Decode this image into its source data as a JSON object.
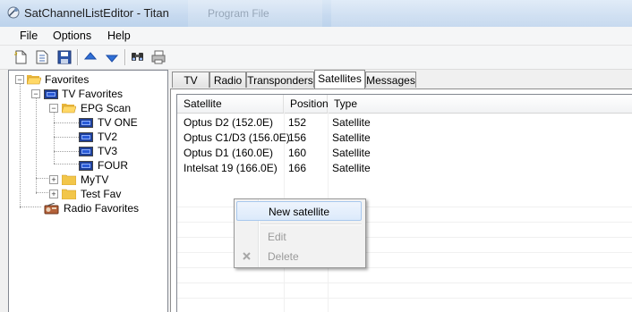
{
  "window": {
    "title": "SatChannelListEditor - Titan",
    "background_window_title": "Program File"
  },
  "menu": [
    "File",
    "Options",
    "Help"
  ],
  "toolbar": {
    "icons": [
      "new-icon",
      "new-list-icon",
      "save-icon",
      "move-up-icon",
      "move-down-icon",
      "find-icon",
      "print-icon"
    ]
  },
  "tree": {
    "favorites": "Favorites",
    "tv_favorites": "TV Favorites",
    "epg_scan": "EPG Scan",
    "channels": [
      "TV ONE",
      "TV2",
      "TV3",
      "FOUR"
    ],
    "mytv": "MyTV",
    "test_fav": "Test Fav",
    "radio_favorites": "Radio Favorites"
  },
  "tabs": [
    {
      "label": "TV"
    },
    {
      "label": "Radio"
    },
    {
      "label": "Transponders"
    },
    {
      "label": "Satellites",
      "active": true
    },
    {
      "label": "Messages"
    }
  ],
  "list": {
    "columns": [
      "Satellite",
      "Position",
      "Type"
    ],
    "rows": [
      [
        "Optus D2 (152.0E)",
        "152",
        "Satellite"
      ],
      [
        "Optus C1/D3 (156.0E)",
        "156",
        "Satellite"
      ],
      [
        "Optus D1 (160.0E)",
        "160",
        "Satellite"
      ],
      [
        "Intelsat 19 (166.0E)",
        "166",
        "Satellite"
      ]
    ]
  },
  "context_menu": {
    "new_satellite": "New satellite",
    "edit": "Edit",
    "delete": "Delete"
  }
}
